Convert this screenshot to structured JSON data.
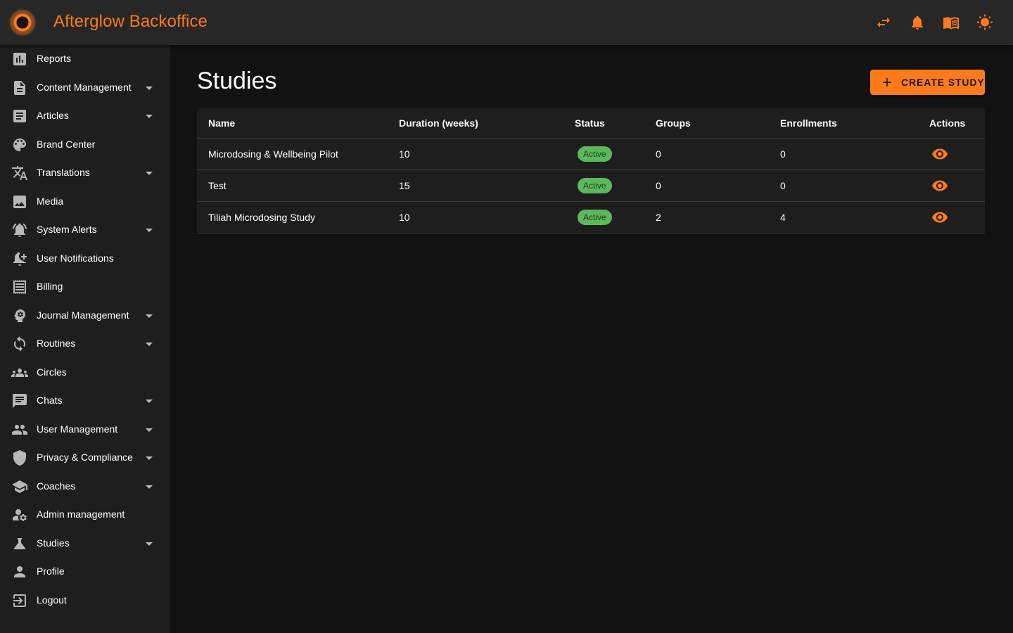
{
  "app": {
    "title": "Afterglow Backoffice",
    "accent": "#ff7a1a"
  },
  "topbar_icons": [
    "swap-icon",
    "bell-icon",
    "book-icon",
    "sun-icon"
  ],
  "sidebar": {
    "items": [
      {
        "label": "Reports",
        "icon": "bar-chart-icon",
        "expandable": false
      },
      {
        "label": "Content Management",
        "icon": "document-icon",
        "expandable": true
      },
      {
        "label": "Articles",
        "icon": "article-icon",
        "expandable": true
      },
      {
        "label": "Brand Center",
        "icon": "palette-icon",
        "expandable": false
      },
      {
        "label": "Translations",
        "icon": "translate-icon",
        "expandable": true
      },
      {
        "label": "Media",
        "icon": "image-icon",
        "expandable": false
      },
      {
        "label": "System Alerts",
        "icon": "alarm-icon",
        "expandable": true
      },
      {
        "label": "User Notifications",
        "icon": "bell-add-icon",
        "expandable": false
      },
      {
        "label": "Billing",
        "icon": "receipt-icon",
        "expandable": false
      },
      {
        "label": "Journal Management",
        "icon": "psychology-icon",
        "expandable": true
      },
      {
        "label": "Routines",
        "icon": "sync-icon",
        "expandable": true
      },
      {
        "label": "Circles",
        "icon": "groups-icon",
        "expandable": false
      },
      {
        "label": "Chats",
        "icon": "chat-icon",
        "expandable": true
      },
      {
        "label": "User Management",
        "icon": "people-icon",
        "expandable": true
      },
      {
        "label": "Privacy & Compliance",
        "icon": "shield-icon",
        "expandable": true
      },
      {
        "label": "Coaches",
        "icon": "school-icon",
        "expandable": true
      },
      {
        "label": "Admin management",
        "icon": "admin-gear-icon",
        "expandable": false
      },
      {
        "label": "Studies",
        "icon": "flask-icon",
        "expandable": true
      },
      {
        "label": "Profile",
        "icon": "person-icon",
        "expandable": false
      },
      {
        "label": "Logout",
        "icon": "logout-icon",
        "expandable": false
      }
    ]
  },
  "main": {
    "title": "Studies",
    "create_button": "CREATE STUDY",
    "table": {
      "headers": [
        "Name",
        "Duration (weeks)",
        "Status",
        "Groups",
        "Enrollments",
        "Actions"
      ],
      "rows": [
        {
          "name": "Microdosing & Wellbeing Pilot",
          "duration": "10",
          "status": "Active",
          "groups": "0",
          "enrollments": "0"
        },
        {
          "name": "Test",
          "duration": "15",
          "status": "Active",
          "groups": "0",
          "enrollments": "0"
        },
        {
          "name": "Tiliah Microdosing Study",
          "duration": "10",
          "status": "Active",
          "groups": "2",
          "enrollments": "4"
        }
      ]
    }
  },
  "colors": {
    "status_active": "#5cb85c",
    "accent": "#ff7a1a",
    "background": "#121212",
    "surface": "#1e1e1e"
  }
}
